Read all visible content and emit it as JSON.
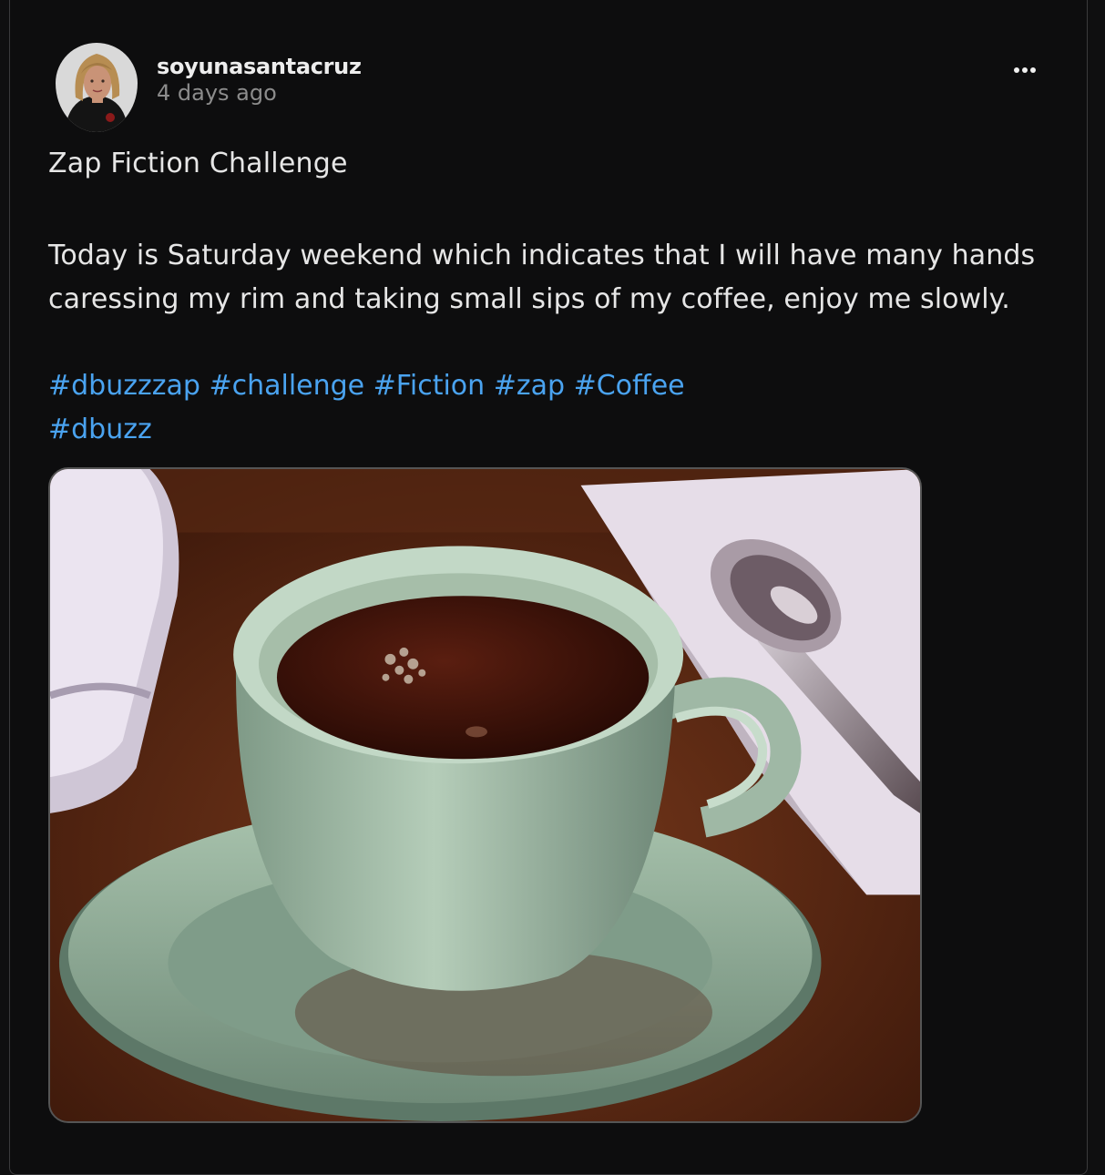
{
  "post": {
    "username": "soyunasantacruz",
    "timestamp": "4 days ago",
    "title": "Zap Fiction Challenge",
    "body": "Today is Saturday weekend which indicates that I will have many hands caressing my rim and taking small sips of my coffee, enjoy me slowly.",
    "tags_line1": [
      "#dbuzzzap",
      "#challenge",
      "#Fiction",
      "#zap",
      "#Coffee"
    ],
    "tags_line2": [
      "#dbuzz"
    ]
  },
  "icons": {
    "more": "more-horizontal-icon"
  },
  "colors": {
    "background": "#0d0d0e",
    "text": "#e6e6e6",
    "muted": "#8c8c8c",
    "link": "#4aa3f0"
  }
}
